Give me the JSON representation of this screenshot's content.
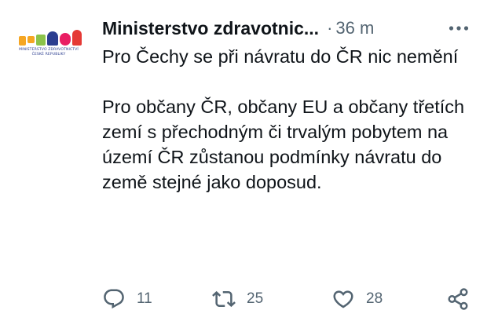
{
  "tweet": {
    "author": {
      "name": "Ministerstvo zdravotnic...",
      "avatar_text": "MINISTERSTVO ZDRAVOTNICTVÍ ČESKÉ REPUBLIKY",
      "avatar_colors": [
        "#f5a623",
        "#8bc34a",
        "#e91e63",
        "#2b3d8f",
        "#e53935"
      ]
    },
    "separator": "·",
    "time": "36 m",
    "more_icon": "more-horizontal-icon",
    "text_paragraph_1": "Pro Čechy se při návratu do ČR nic nemění",
    "text_paragraph_2": "Pro občany ČR, občany EU a občany třetích zemí s přechodným či trvalým pobytem na území ČR zůstanou podmínky návratu do země stejné jako doposud.",
    "actions": {
      "reply": {
        "icon": "reply-icon",
        "count": "11"
      },
      "retweet": {
        "icon": "retweet-icon",
        "count": "25"
      },
      "like": {
        "icon": "heart-icon",
        "count": "28"
      },
      "share": {
        "icon": "share-icon"
      }
    },
    "colors": {
      "text": "#0f1419",
      "secondary": "#536471"
    }
  }
}
